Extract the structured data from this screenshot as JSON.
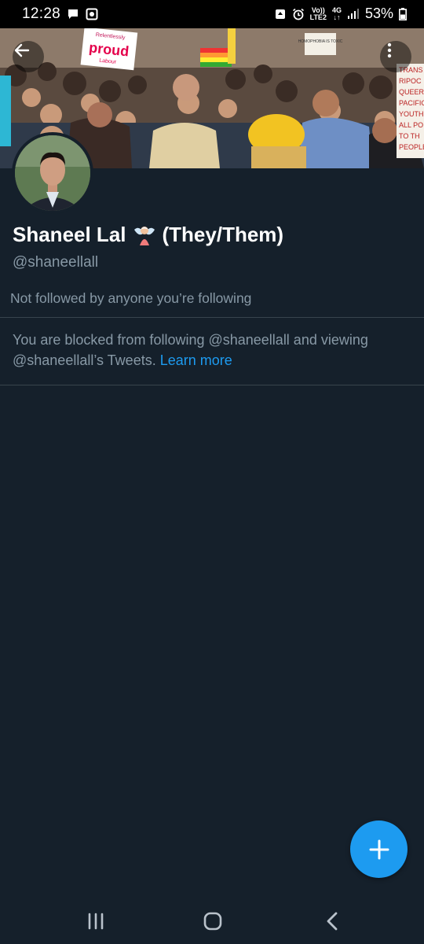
{
  "status_bar": {
    "time": "12:28",
    "network_top": "Vo))",
    "network_bottom": "LTE2",
    "net_type": "4G",
    "battery": "53%"
  },
  "banner": {
    "sign_top": "Relentlessly",
    "sign_main": "proud",
    "sign_sub": "Labour",
    "sign_small": "HOMOPHOBIA IS TOXIC",
    "sign_right": [
      "TRANS",
      "RIPOC",
      "QUEER",
      "PACIFIC",
      "YOUTH F",
      "ALL PO",
      "TO TH",
      "PEOPLE"
    ]
  },
  "profile": {
    "name": "Shaneel Lal",
    "pronouns": "(They/Them)",
    "handle": "@shaneellall",
    "followed_by": "Not followed by anyone you’re following",
    "blocked_text": "You are blocked from following @shaneellall and viewing @shaneellall’s Tweets.",
    "learn_more": "Learn more"
  },
  "colors": {
    "background": "#15202b",
    "accent": "#1d9bf0",
    "secondary_text": "#8899a6",
    "divider": "#38444d"
  },
  "icons": {
    "back": "arrow-left-icon",
    "more": "more-vertical-icon",
    "fab": "plus-icon",
    "emoji": "fairy-emoji"
  }
}
